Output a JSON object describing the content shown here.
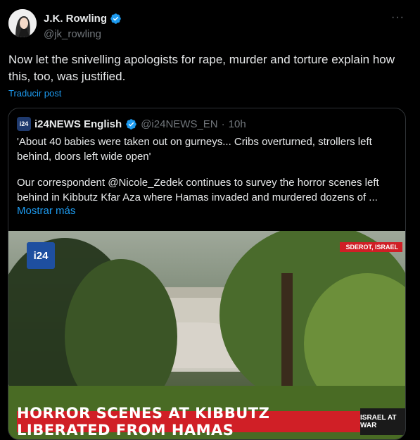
{
  "author": {
    "name": "J.K. Rowling",
    "handle": "@jk_rowling"
  },
  "post": {
    "text": "Now let the snivelling apologists for rape, murder and torture explain how this, too, was justified.",
    "translate_label": "Traducir post"
  },
  "quote": {
    "name": "i24NEWS English",
    "handle": "@i24NEWS_EN",
    "separator": "·",
    "time": "10h",
    "text1": "'About 40 babies were taken out on gurneys... Cribs overturned, strollers left behind, doors left wide open'",
    "text2": "Our correspondent @Nicole_Zedek continues to survey the horror scenes left behind in Kibbutz Kfar Aza where Hamas invaded and murdered dozens of ...",
    "show_more": "Mostrar más"
  },
  "media": {
    "channel_logo": "i24",
    "location": "SDEROT, ISRAEL",
    "headline": "HORROR SCENES AT KIBBUTZ LIBERATED FROM HAMAS",
    "badge": "ISRAEL AT WAR"
  },
  "icons": {
    "verified": "verified-badge-icon",
    "more": "more-options-icon"
  },
  "colors": {
    "accent": "#1d9bf0",
    "background": "#000000",
    "banner": "#d01f26"
  }
}
